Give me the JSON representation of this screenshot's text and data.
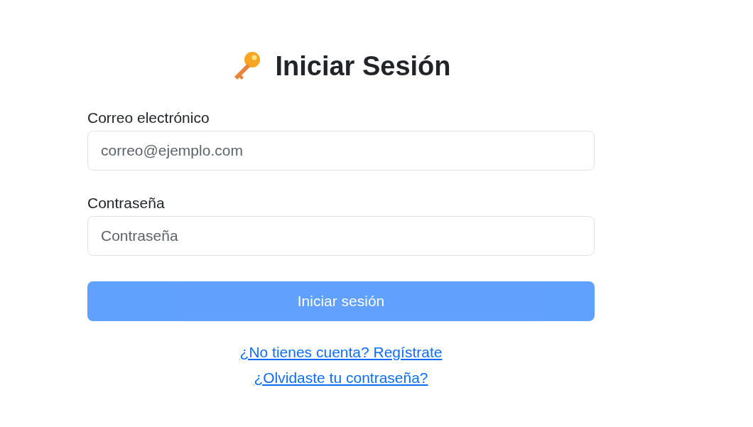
{
  "title": "Iniciar Sesión",
  "fields": [
    {
      "label": "Correo electrónico",
      "placeholder": "correo@ejemplo.com"
    },
    {
      "label": "Contraseña",
      "placeholder": "Contraseña"
    }
  ],
  "submit": {
    "label": "Iniciar sesión",
    "disabled": true
  },
  "links": [
    "¿No tienes cuenta? Regístrate",
    "¿Olvidaste tu contraseña?"
  ]
}
